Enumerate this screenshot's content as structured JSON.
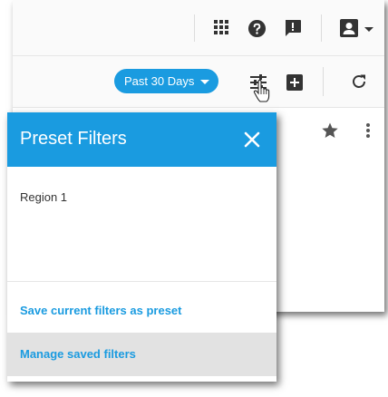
{
  "header": {
    "apps_icon": "apps-grid-icon",
    "help_icon": "help-circle-icon",
    "feedback_icon": "feedback-icon",
    "account_icon": "account-box-icon"
  },
  "toolbar": {
    "date_range_label": "Past 30 Days",
    "filter_icon": "filter-sliders-icon",
    "add_icon": "add-box-icon",
    "refresh_icon": "refresh-icon",
    "favorite_icon": "star-icon",
    "more_icon": "more-vert-icon"
  },
  "preset_filters": {
    "title": "Preset Filters",
    "items": [
      {
        "label": "Region 1"
      }
    ],
    "save_label": "Save current filters as preset",
    "manage_label": "Manage saved filters"
  },
  "colors": {
    "accent": "#1a9be0",
    "icon_dark": "#333333",
    "hover_row": "#e2e2e2"
  }
}
